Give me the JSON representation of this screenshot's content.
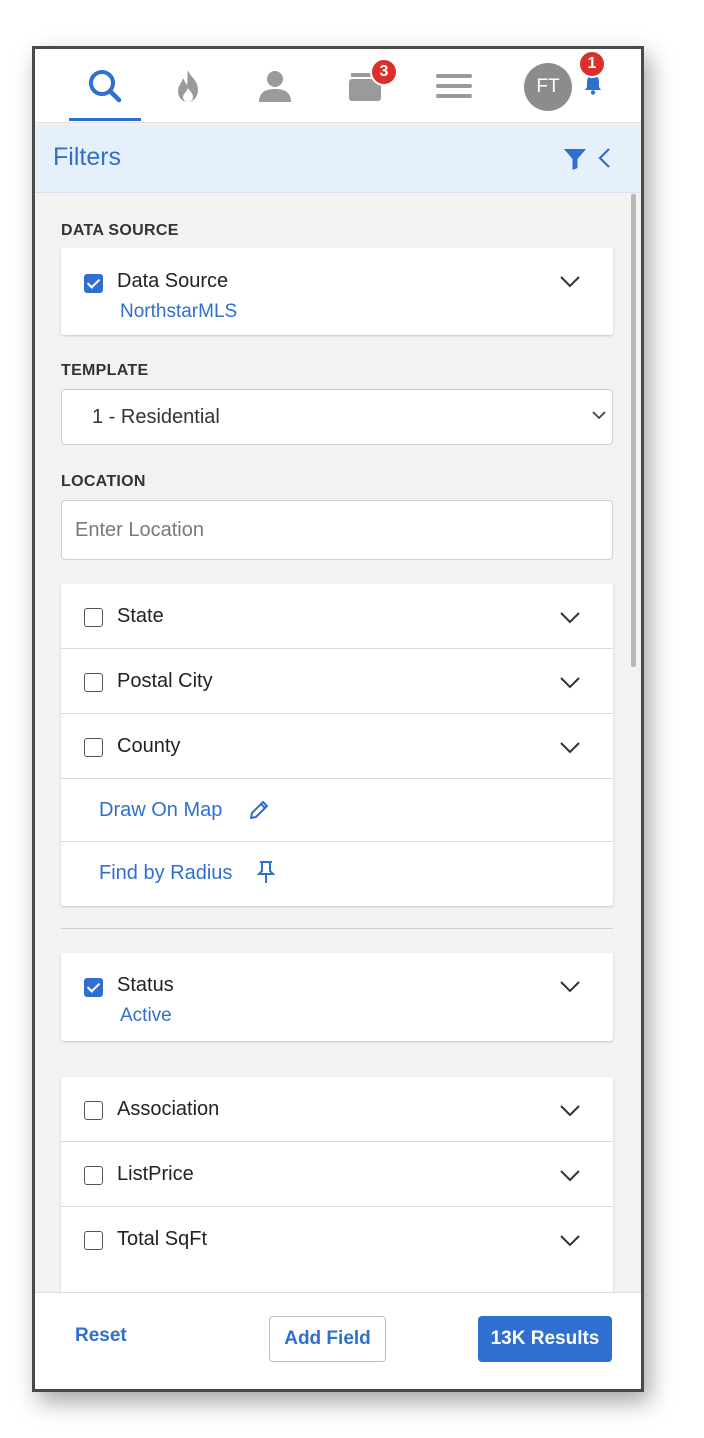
{
  "nav": {
    "items": [
      {
        "name": "search",
        "icon": "search-icon",
        "active": true
      },
      {
        "name": "hot",
        "icon": "flame-icon"
      },
      {
        "name": "contacts",
        "icon": "person-icon"
      },
      {
        "name": "carts",
        "icon": "folder-icon",
        "badge": "3"
      },
      {
        "name": "menu",
        "icon": "hamburger-icon"
      }
    ],
    "avatar_initials": "FT",
    "notifications_badge": "1",
    "accent_color": "#2f6fcf",
    "badge_color": "#d9302c"
  },
  "filters": {
    "title": "Filters"
  },
  "data_source": {
    "section_label": "DATA SOURCE",
    "label": "Data Source",
    "value": "NorthstarMLS",
    "checked": true
  },
  "template": {
    "section_label": "TEMPLATE",
    "selected": "1 - Residential"
  },
  "location": {
    "section_label": "LOCATION",
    "placeholder": "Enter Location",
    "rows": [
      {
        "label": "State",
        "checked": false
      },
      {
        "label": "Postal City",
        "checked": false
      },
      {
        "label": "County",
        "checked": false
      }
    ],
    "draw_on_map": "Draw On Map",
    "find_by_radius": "Find by Radius"
  },
  "status": {
    "label": "Status",
    "value": "Active",
    "checked": true
  },
  "fields": [
    {
      "label": "Association",
      "checked": false
    },
    {
      "label": "ListPrice",
      "checked": false
    },
    {
      "label": "Total SqFt",
      "checked": false
    }
  ],
  "footer": {
    "reset": "Reset",
    "add_field": "Add Field",
    "results": "13K Results"
  }
}
